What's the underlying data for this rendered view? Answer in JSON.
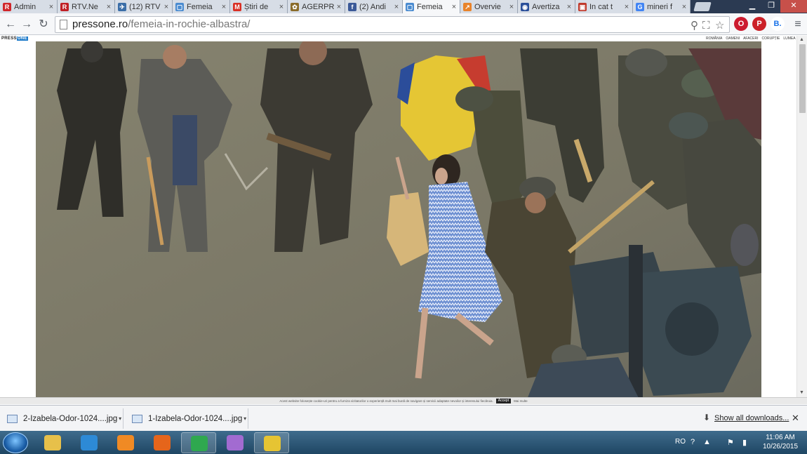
{
  "browser": {
    "tabs": [
      {
        "label": "Admin",
        "icon": "R",
        "color": "#d0262a"
      },
      {
        "label": "RTV.Ne",
        "icon": "R",
        "color": "#c01f25"
      },
      {
        "label": "(12) RTV",
        "icon": "✈",
        "color": "#3b6ea8"
      },
      {
        "label": "Femeia",
        "icon": "▢",
        "color": "#4a8bd0"
      },
      {
        "label": "Știri de",
        "icon": "M",
        "color": "#d93025"
      },
      {
        "label": "AGERPR",
        "icon": "✿",
        "color": "#8a6b2a"
      },
      {
        "label": "(2) Andi",
        "icon": "f",
        "color": "#3b5998"
      },
      {
        "label": "Femeia",
        "icon": "▢",
        "color": "#4a8bd0",
        "active": true
      },
      {
        "label": "Overvie",
        "icon": "↗",
        "color": "#e8832b"
      },
      {
        "label": "Avertiza",
        "icon": "◉",
        "color": "#2a4f9a"
      },
      {
        "label": "In cat t",
        "icon": "▣",
        "color": "#c0392b"
      },
      {
        "label": "mineri f",
        "icon": "G",
        "color": "#4285f4"
      }
    ],
    "url": {
      "host": "pressone.ro",
      "path": "/femeia-in-rochie-albastra/"
    },
    "extensions": [
      {
        "name": "opera-ext",
        "color": "#cc1b2f",
        "glyph": "O"
      },
      {
        "name": "pinterest-ext",
        "color": "#cb2027",
        "glyph": "P"
      },
      {
        "name": "b-ext",
        "color": "#ffffff",
        "glyph": "B."
      }
    ]
  },
  "site": {
    "logo": "PRESS",
    "logo_accent": "ONE",
    "nav": [
      "ROMÂNIA",
      "OAMENI",
      "AFACERI",
      "CORUPȚIE",
      "LUMEA"
    ]
  },
  "cookie": {
    "text": "Acest website folosește cookie-uri pentru a furniza vizitatorilor o experiență mult mai bună de navigare și servicii adaptate nevoilor și interesului fiecăruia.",
    "accept": "Accept",
    "more": "Mai multe"
  },
  "downloads": {
    "items": [
      {
        "name": "2-Izabela-Odor-1024....jpg"
      },
      {
        "name": "1-Izabela-Odor-1024....jpg"
      }
    ],
    "show_all": "Show all downloads..."
  },
  "taskbar": {
    "apps": [
      {
        "name": "explorer",
        "color": "#e7c04a"
      },
      {
        "name": "internet-explorer",
        "color": "#2d8ad6"
      },
      {
        "name": "media-player",
        "color": "#f08a24"
      },
      {
        "name": "firefox",
        "color": "#e5651b"
      },
      {
        "name": "chrome",
        "color": "#2fa84f",
        "active": true
      },
      {
        "name": "app-6",
        "color": "#a26bd1"
      },
      {
        "name": "security-shield",
        "color": "#e6c433",
        "active": true
      }
    ],
    "lang": "RO",
    "time": "11:06 AM",
    "date": "10/26/2015"
  }
}
